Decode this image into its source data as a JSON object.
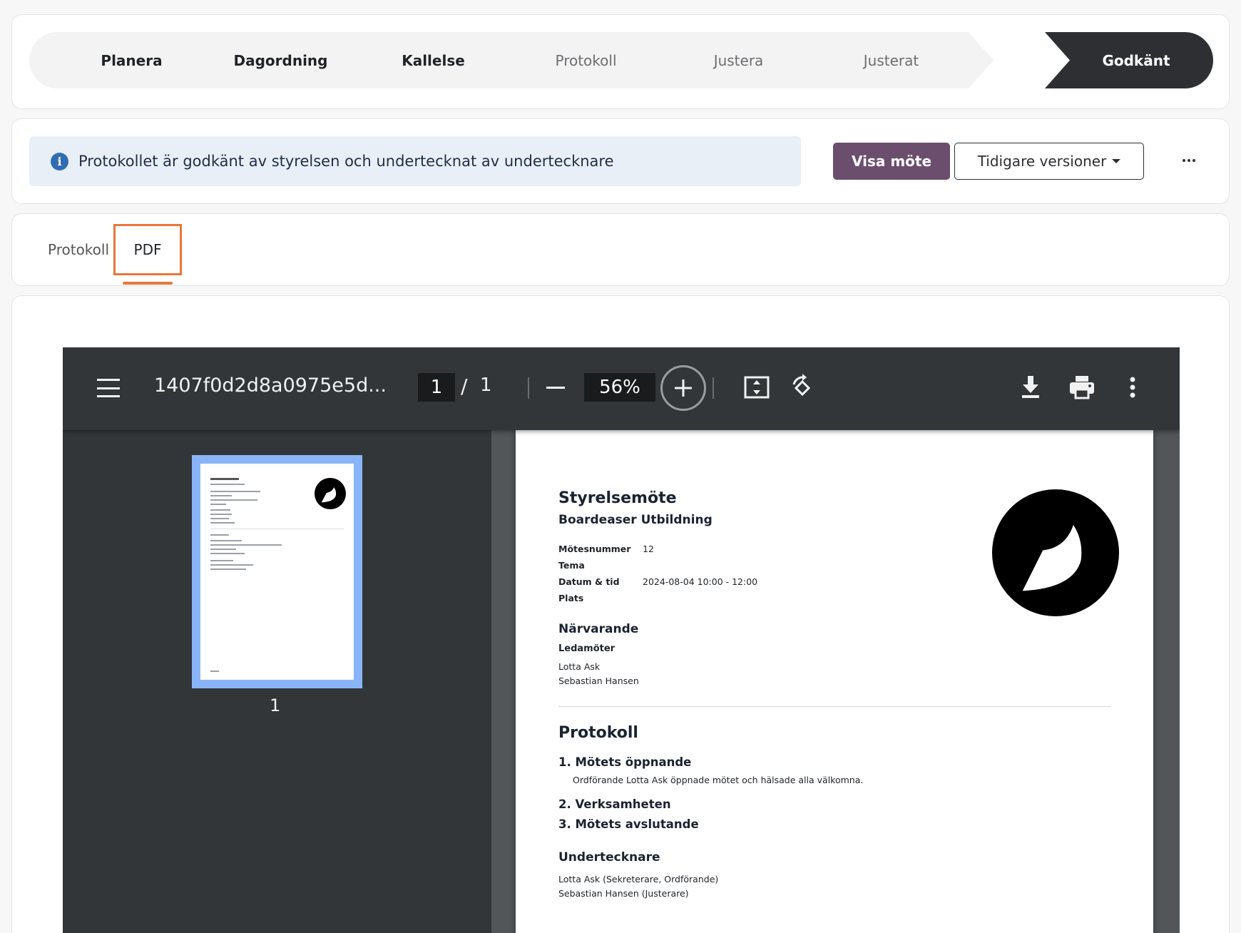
{
  "stepper": {
    "steps": [
      {
        "label": "Planera",
        "state": "done"
      },
      {
        "label": "Dagordning",
        "state": "done"
      },
      {
        "label": "Kallelse",
        "state": "done"
      },
      {
        "label": "Protokoll",
        "state": "inactive"
      },
      {
        "label": "Justera",
        "state": "inactive"
      },
      {
        "label": "Justerat",
        "state": "inactive"
      },
      {
        "label": "Godkänt",
        "state": "current"
      }
    ]
  },
  "status": {
    "icon": "info-icon",
    "icon_glyph": "i",
    "message": "Protokollet är godkänt av styrelsen och undertecknat av undertecknare",
    "view_meeting_label": "Visa möte",
    "previous_versions_label": "Tidigare versioner",
    "more_icon": "more-horizontal-icon"
  },
  "tabs": {
    "items": [
      "Protokoll",
      "PDF"
    ],
    "active": "PDF"
  },
  "pdf_viewer": {
    "file_name": "1407f0d2d8a0975e5d...",
    "current_page": "1",
    "page_separator": "/",
    "total_pages": "1",
    "zoom": "56%",
    "thumbnail_label": "1",
    "toolbar_icons": [
      "menu-icon",
      "zoom-out-icon",
      "zoom-in-icon",
      "fit-page-icon",
      "rotate-icon",
      "download-icon",
      "print-icon",
      "more-vertical-icon"
    ]
  },
  "document": {
    "title": "Styrelsemöte",
    "subtitle": "Boardeaser Utbildning",
    "meta": [
      {
        "label": "Mötesnummer",
        "value": "12"
      },
      {
        "label": "Tema",
        "value": ""
      },
      {
        "label": "Datum & tid",
        "value": "2024-08-04 10:00 - 12:00"
      },
      {
        "label": "Plats",
        "value": ""
      }
    ],
    "attendance_heading": "Närvarande",
    "members_heading": "Ledamöter",
    "members": [
      "Lotta Ask",
      "Sebastian Hansen"
    ],
    "protocol_heading": "Protokoll",
    "items": [
      {
        "title": "1. Mötets öppnande",
        "text": "Ordförande Lotta Ask öppnade mötet och hälsade alla välkomna."
      },
      {
        "title": "2. Verksamheten",
        "text": ""
      },
      {
        "title": "3. Mötets avslutande",
        "text": ""
      }
    ],
    "signers_heading": "Undertecknare",
    "signers": [
      "Lotta Ask (Sekreterare, Ordförande)",
      "Sebastian Hansen (Justerare)"
    ],
    "logo_icon": "boardeaser-logo-icon"
  }
}
